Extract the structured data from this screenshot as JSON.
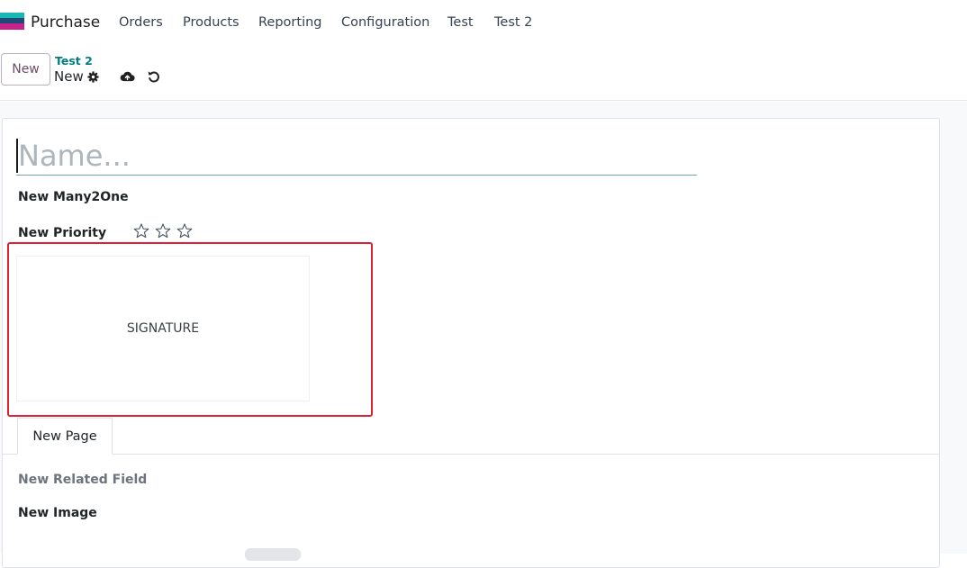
{
  "nav": {
    "app_name": "Purchase",
    "menu": [
      "Orders",
      "Products",
      "Reporting",
      "Configuration",
      "Test",
      "Test 2"
    ],
    "logo_colors": [
      "#1ab7b3",
      "#1f4a77",
      "#c6228a"
    ]
  },
  "control_panel": {
    "new_label": "New",
    "breadcrumb_parent": "Test 2",
    "breadcrumb_current": "New",
    "icons": [
      "gear-icon",
      "cloud-upload-icon",
      "undo-icon"
    ]
  },
  "form": {
    "name_placeholder": "Name...",
    "name_value": "",
    "many2one_label": "New Many2One",
    "priority_label": "New Priority",
    "priority_value": 0,
    "priority_max": 3,
    "signature_text": "SIGNATURE",
    "tabs": [
      "New Page"
    ],
    "related_field_label": "New Related Field",
    "image_label": "New Image"
  },
  "colors": {
    "accent_teal": "#017e84",
    "brand_purple": "#714b67",
    "highlight_red": "#dc2237"
  }
}
